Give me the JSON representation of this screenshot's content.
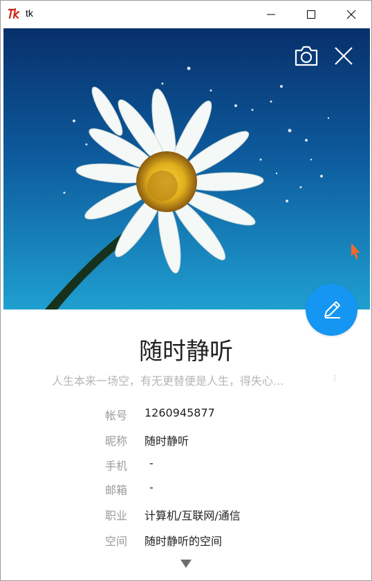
{
  "window": {
    "title": "tk",
    "icon": "tk-feather-icon"
  },
  "hero": {
    "camera_icon": "camera-icon",
    "close_icon": "close-icon"
  },
  "profile": {
    "name": "随时静听",
    "signature": "人生本来一场空，有无更替便是人生，得失心...",
    "signature_mark": "⁝",
    "edit_icon": "pencil-icon"
  },
  "info": [
    {
      "label": "帐号",
      "value": "1260945877"
    },
    {
      "label": "昵称",
      "value": "随时静听"
    },
    {
      "label": "手机",
      "value": "-"
    },
    {
      "label": "邮箱",
      "value": "-"
    },
    {
      "label": "职业",
      "value": "计算机/互联网/通信"
    },
    {
      "label": "空间",
      "value": "随时静听的空间"
    }
  ],
  "more_icon": "caret-down-icon",
  "colors": {
    "accent": "#1596f3",
    "label": "#9a9a9a",
    "value": "#222222"
  }
}
